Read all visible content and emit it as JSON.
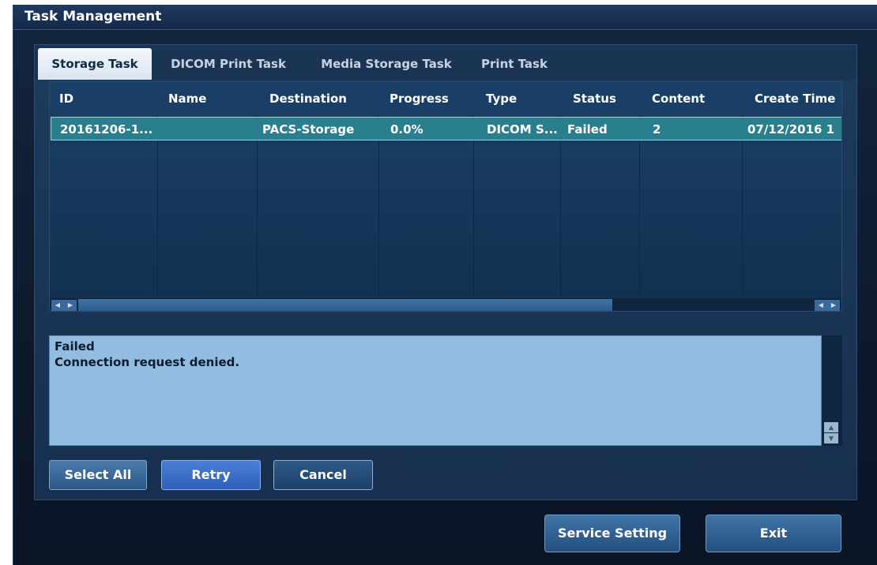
{
  "window": {
    "title": "Task Management"
  },
  "tabs": [
    {
      "label": "Storage Task",
      "active": true
    },
    {
      "label": "DICOM Print Task",
      "active": false
    },
    {
      "label": "Media Storage Task",
      "active": false
    },
    {
      "label": "Print Task",
      "active": false
    }
  ],
  "table": {
    "columns": [
      "ID",
      "Name",
      "Destination",
      "Progress",
      "Type",
      "Status",
      "Content",
      "Create Time"
    ],
    "rows": [
      [
        "20161206-1...",
        "",
        "PACS-Storage",
        "0.0%",
        "DICOM S...",
        "Failed",
        "2",
        "07/12/2016 1"
      ]
    ]
  },
  "message": {
    "lines": [
      "Failed",
      "Connection request denied."
    ]
  },
  "actions": {
    "select_all": "Select All",
    "retry": "Retry",
    "cancel": "Cancel"
  },
  "footer": {
    "service_setting": "Service Setting",
    "exit": "Exit"
  },
  "icons": {
    "scroll_left": "arrow-left-icon",
    "scroll_right": "arrow-right-icon",
    "scroll_up": "arrow-up-icon",
    "scroll_down": "arrow-down-icon"
  },
  "colors": {
    "selected_row": "#2a7f8f",
    "active_tab": "#e8eef5",
    "message_bg": "#92bde0",
    "retry_button": "#3a6fcc"
  }
}
